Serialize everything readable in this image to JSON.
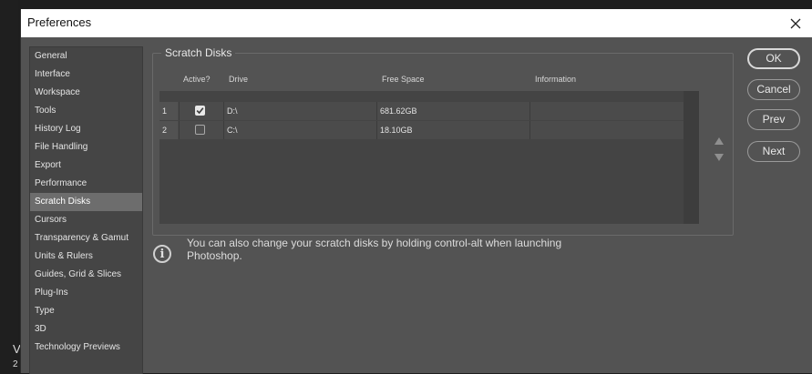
{
  "window": {
    "title": "Preferences"
  },
  "background": {
    "char_v": "V",
    "char_2": "2"
  },
  "sidebar": {
    "items": [
      {
        "label": "General"
      },
      {
        "label": "Interface"
      },
      {
        "label": "Workspace"
      },
      {
        "label": "Tools"
      },
      {
        "label": "History Log"
      },
      {
        "label": "File Handling"
      },
      {
        "label": "Export"
      },
      {
        "label": "Performance"
      },
      {
        "label": "Scratch Disks",
        "selected": true
      },
      {
        "label": "Cursors"
      },
      {
        "label": "Transparency & Gamut"
      },
      {
        "label": "Units & Rulers"
      },
      {
        "label": "Guides, Grid & Slices"
      },
      {
        "label": "Plug-Ins"
      },
      {
        "label": "Type"
      },
      {
        "label": "3D"
      },
      {
        "label": "Technology Previews"
      }
    ]
  },
  "scratch_disks": {
    "heading": "Scratch Disks",
    "columns": {
      "active": "Active?",
      "drive": "Drive",
      "free_space": "Free Space",
      "information": "Information"
    },
    "rows": [
      {
        "num": "1",
        "active": true,
        "drive": "D:\\",
        "free_space": "681.62GB",
        "information": ""
      },
      {
        "num": "2",
        "active": false,
        "drive": "C:\\",
        "free_space": "18.10GB",
        "information": ""
      }
    ]
  },
  "info": {
    "icon": "info-icon",
    "text": "You can also change your scratch disks by holding control-alt when launching Photoshop."
  },
  "buttons": {
    "ok": "OK",
    "cancel": "Cancel",
    "prev": "Prev",
    "next": "Next"
  },
  "colors": {
    "dialog_bg": "#535353",
    "selected_item": "#6d6d6d",
    "titlebar": "#ffffff"
  }
}
